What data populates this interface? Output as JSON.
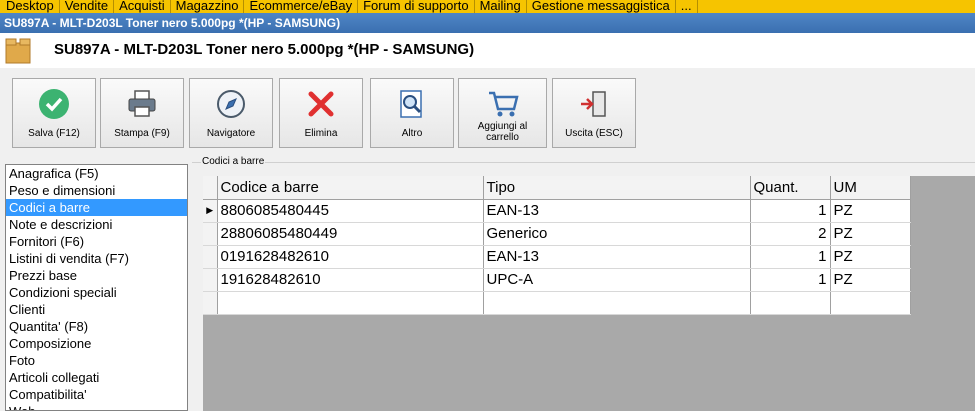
{
  "tabs": [
    "Desktop",
    "Vendite",
    "Acquisti",
    "Magazzino",
    "Ecommerce/eBay",
    "Forum di supporto",
    "Mailing",
    "Gestione messaggistica",
    "..."
  ],
  "window_title": "SU897A - MLT-D203L Toner nero 5.000pg  *(HP - SAMSUNG)",
  "header_title": "SU897A - MLT-D203L Toner nero 5.000pg  *(HP - SAMSUNG)",
  "toolbar": {
    "salva": "Salva (F12)",
    "stampa": "Stampa (F9)",
    "navigatore": "Navigatore",
    "elimina": "Elimina",
    "altro": "Altro",
    "aggiungi_line1": "Aggiungi al",
    "aggiungi_line2": "carrello",
    "uscita": "Uscita (ESC)"
  },
  "nav": {
    "items": [
      "Anagrafica (F5)",
      "Peso e dimensioni",
      "Codici a barre",
      "Note e descrizioni",
      "Fornitori (F6)",
      "Listini di vendita (F7)",
      "Prezzi base",
      "Condizioni speciali",
      "Clienti",
      "Quantita' (F8)",
      "Composizione",
      "Foto",
      "Articoli collegati",
      "Compatibilita'",
      "Web"
    ],
    "selected": "Codici a barre"
  },
  "group_label": "Codici a barre",
  "grid": {
    "headers": [
      "Codice a barre",
      "Tipo",
      "Quant.",
      "UM"
    ],
    "rows": [
      {
        "code": "8806085480445",
        "tipo": "EAN-13",
        "qty": "1",
        "um": "PZ"
      },
      {
        "code": "28806085480449",
        "tipo": "Generico",
        "qty": "2",
        "um": "PZ"
      },
      {
        "code": "0191628482610",
        "tipo": "EAN-13",
        "qty": "1",
        "um": "PZ"
      },
      {
        "code": "191628482610",
        "tipo": "UPC-A",
        "qty": "1",
        "um": "PZ"
      }
    ]
  },
  "colors": {
    "tabbar": "#f6c400",
    "titlebar": "#3a6fb0",
    "selection": "#3399ff",
    "save_green": "#3cb371",
    "delete_red": "#e03030"
  }
}
